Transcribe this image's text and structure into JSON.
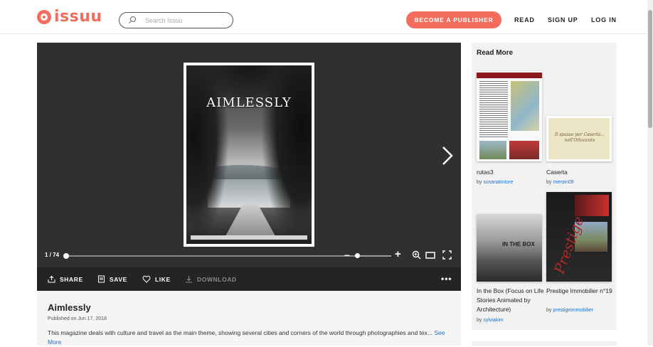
{
  "header": {
    "logo_text": "issuu",
    "search_placeholder": "Search Issuu",
    "publisher_button": "BECOME A PUBLISHER",
    "nav": [
      "READ",
      "SIGN UP",
      "LOG IN"
    ],
    "accent_color": "#f36d5d"
  },
  "reader": {
    "cover_title": "AIMLESSLY",
    "page_indicator": "1 / 74",
    "controls": {
      "zoom_out_icon": "minus-icon",
      "zoom_in_icon": "plus-icon",
      "search_icon": "zoom-magnifier-icon",
      "single_page_icon": "single-page-icon",
      "fullscreen_icon": "fullscreen-icon",
      "next_icon": "chevron-right-icon"
    }
  },
  "actions": {
    "share": "SHARE",
    "save": "SAVE",
    "like": "LIKE",
    "download": "DOWNLOAD",
    "more": "•••"
  },
  "document": {
    "title": "Aimlessly",
    "published": "Published on Jun 17, 2018",
    "description": "This magazine deals with culture and travel as the main theme, showing several cities and corners of the world through photographies and tex...",
    "see_more": "See More"
  },
  "sidebar": {
    "title": "Read More",
    "cards": [
      {
        "title": "rutas3",
        "by": "by",
        "author": "susanatintore"
      },
      {
        "title": "Caserta",
        "by": "by",
        "author": "meroin09",
        "thumb_text": "Il spasso per Caserta... nell'Ottocento"
      },
      {
        "title": "In the Box (Focus on Life Stories Animated by Architecture)",
        "by": "by",
        "author": "sylviakim",
        "thumb_text": "IN THE BOX"
      },
      {
        "title": "Prestige Immobilier n°19",
        "by": "by",
        "author": "prestigeimmobilier",
        "thumb_text": "Prestige"
      }
    ]
  }
}
